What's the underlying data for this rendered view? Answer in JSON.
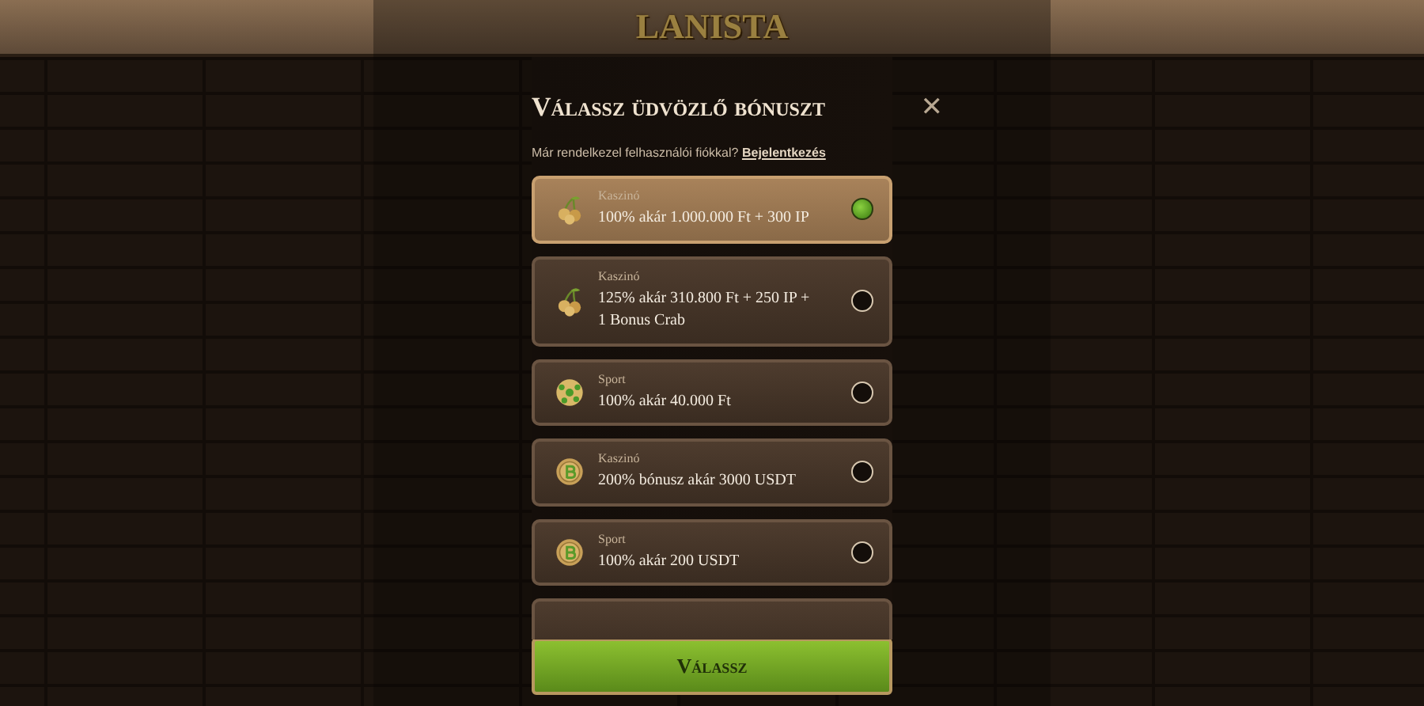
{
  "header": {
    "logo": "LANISTA"
  },
  "modal": {
    "title": "Válassz üdvözlő bónuszt",
    "close": "✕",
    "login_prompt": "Már rendelkezel felhasználói fiókkal?",
    "login_link": "Bejelentkezés"
  },
  "options": [
    {
      "kind": "cherries",
      "category": "Kaszinó",
      "offer": "100% akár 1.000.000 Ft + 300 IP",
      "selected": true
    },
    {
      "kind": "cherries",
      "category": "Kaszinó",
      "offer": "125% akár 310.800 Ft + 250 IP + 1 Bonus Crab",
      "selected": false
    },
    {
      "kind": "ball",
      "category": "Sport",
      "offer": "100% akár 40.000 Ft",
      "selected": false
    },
    {
      "kind": "coin",
      "category": "Kaszinó",
      "offer": "200% bónusz akár 3000 USDT",
      "selected": false
    },
    {
      "kind": "coin",
      "category": "Sport",
      "offer": "100% akár 200 USDT",
      "selected": false
    }
  ],
  "submit": "Válassz"
}
